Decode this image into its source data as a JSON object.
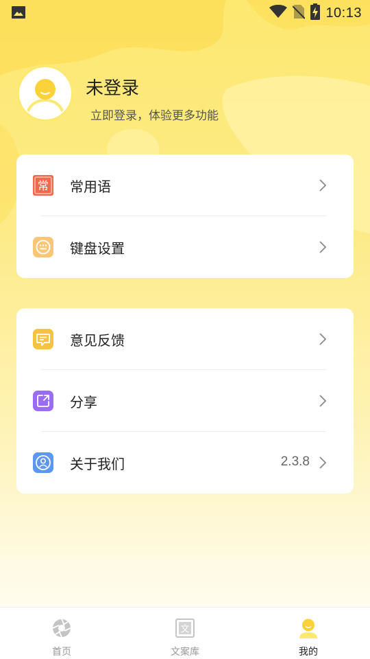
{
  "status_bar": {
    "time": "10:13",
    "icons": [
      "image-icon",
      "wifi-icon",
      "no-sim-icon",
      "battery-charging-icon"
    ]
  },
  "profile": {
    "title": "未登录",
    "subtitle": "立即登录，体验更多功能"
  },
  "menu_group_1": [
    {
      "label": "常用语",
      "icon": "common-phrases-icon",
      "icon_char": "常",
      "color": "#ee6a4d"
    },
    {
      "label": "键盘设置",
      "icon": "keyboard-icon",
      "color": "#f8c878"
    }
  ],
  "menu_group_2": [
    {
      "label": "意见反馈",
      "icon": "feedback-icon",
      "color": "#f5c341"
    },
    {
      "label": "分享",
      "icon": "share-icon",
      "color": "#9a6cf1"
    },
    {
      "label": "关于我们",
      "icon": "about-us-icon",
      "color": "#5e97f0",
      "value": "2.3.8"
    }
  ],
  "bottom_nav": [
    {
      "label": "首页",
      "icon": "aperture-icon",
      "active": false
    },
    {
      "label": "文案库",
      "icon": "text-library-icon",
      "icon_char": "文",
      "active": false
    },
    {
      "label": "我的",
      "icon": "profile-icon",
      "active": true
    }
  ],
  "colors": {
    "accent_yellow": "#fde870",
    "active_yellow": "#fbd23a",
    "text_primary": "#222222",
    "text_secondary": "#666666"
  }
}
